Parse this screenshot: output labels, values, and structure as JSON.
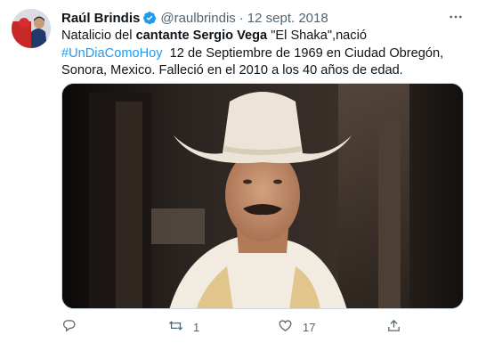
{
  "tweet": {
    "author_name": "Raúl Brindis",
    "handle": "@raulbrindis",
    "separator": "·",
    "date": "12 sept. 2018",
    "text": {
      "part1": "Natalicio del ",
      "bold": "cantante Sergio Vega",
      "part2": " \"El Shaka\",nació ",
      "hashtag": "#UnDiaComoHoy",
      "part3": "  12 de Septiembre de 1969 en Ciudad Obregón, Sonora, Mexico. Falleció en el 2010 a los 40 años de edad."
    },
    "actions": {
      "reply_count": "",
      "retweet_count": "1",
      "like_count": "17",
      "share_count": ""
    }
  },
  "icons": {
    "verified": "verified-badge-icon",
    "more": "more-options-icon",
    "reply": "reply-icon",
    "retweet": "retweet-icon",
    "like": "like-icon",
    "share": "share-icon"
  },
  "colors": {
    "accent": "#1d9bf0",
    "text": "#0f1419",
    "secondary": "#536471"
  }
}
